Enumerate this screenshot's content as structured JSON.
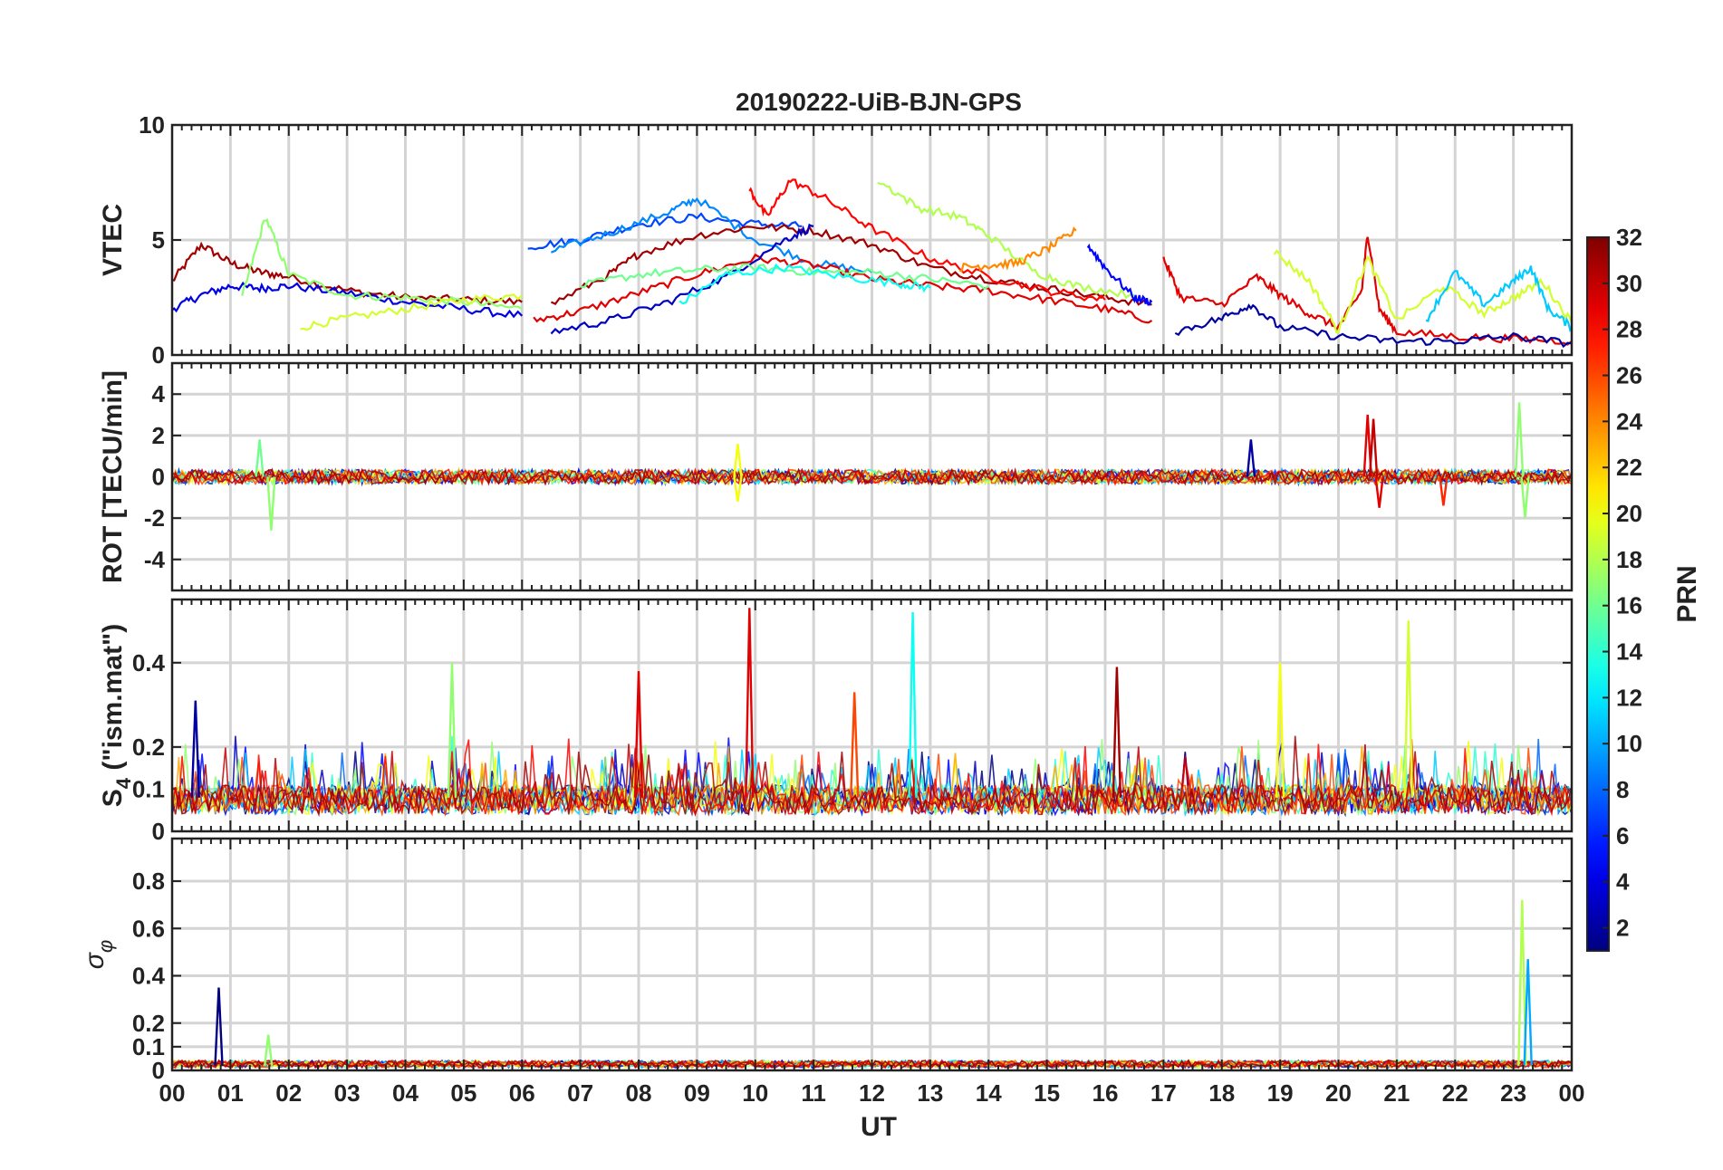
{
  "chart_data": {
    "type": "line",
    "title": "20190222-UiB-BJN-GPS",
    "xlabel": "UT",
    "x_tick_labels": [
      "00",
      "01",
      "02",
      "03",
      "04",
      "05",
      "06",
      "07",
      "08",
      "09",
      "10",
      "11",
      "12",
      "13",
      "14",
      "15",
      "16",
      "17",
      "18",
      "19",
      "20",
      "21",
      "22",
      "23",
      "00"
    ],
    "xlim": [
      0,
      24
    ],
    "grid": true,
    "colorbar": {
      "label": "PRN",
      "colormap": "jet",
      "range": [
        1,
        32
      ],
      "tick_labels": [
        "2",
        "4",
        "6",
        "8",
        "10",
        "12",
        "14",
        "16",
        "18",
        "20",
        "22",
        "24",
        "26",
        "28",
        "30",
        "32"
      ]
    },
    "panels": [
      {
        "id": "vtec",
        "ylabel": "VTEC",
        "ylim": [
          0,
          10
        ],
        "y_ticks": [
          0,
          5,
          10
        ],
        "y_tick_labels": [
          "0",
          "5",
          "10"
        ],
        "series": [
          {
            "prn": 31,
            "x": [
              0,
              0.5,
              1.0,
              1.5,
              2.0,
              3.0,
              4.0,
              5.0,
              6.0
            ],
            "y": [
              3.2,
              4.8,
              4.0,
              3.6,
              3.4,
              2.8,
              2.5,
              2.4,
              2.3
            ]
          },
          {
            "prn": 4,
            "x": [
              0,
              0.5,
              1.0,
              1.5,
              2.0,
              3.0,
              4.0,
              5.0,
              6.0
            ],
            "y": [
              2.0,
              2.6,
              3.0,
              2.9,
              3.0,
              2.7,
              2.3,
              2.0,
              1.7
            ]
          },
          {
            "prn": 17,
            "x": [
              1.2,
              1.6,
              2.0,
              3.0,
              4.0,
              5.0,
              6.0
            ],
            "y": [
              2.5,
              6.0,
              3.5,
              2.6,
              2.5,
              2.3,
              2.0
            ]
          },
          {
            "prn": 19,
            "x": [
              2.2,
              3.0,
              4.0,
              5.0,
              6.0
            ],
            "y": [
              1.2,
              1.6,
              2.0,
              2.4,
              2.6
            ]
          },
          {
            "prn": 7,
            "x": [
              6.1,
              7.0,
              8.0,
              9.0,
              10.0,
              10.8
            ],
            "y": [
              4.7,
              5.0,
              5.7,
              6.0,
              5.7,
              5.6
            ]
          },
          {
            "prn": 9,
            "x": [
              6.5,
              7.5,
              8.5,
              9.0,
              10.0,
              11.0,
              12.0
            ],
            "y": [
              4.5,
              5.3,
              6.2,
              6.8,
              5.0,
              4.0,
              3.6
            ]
          },
          {
            "prn": 29,
            "x": [
              6.2,
              7.0,
              8.0,
              9.0,
              10.0,
              11.0,
              12.0,
              13.0,
              14.0,
              15.0,
              16.0,
              16.8
            ],
            "y": [
              1.5,
              1.9,
              2.7,
              3.5,
              4.2,
              3.9,
              3.3,
              3.0,
              2.8,
              2.4,
              2.0,
              1.5
            ]
          },
          {
            "prn": 31,
            "x": [
              6.5,
              7.5,
              8.0,
              9.0,
              10.0,
              11.0,
              12.0,
              13.0,
              14.0,
              15.0,
              16.0,
              16.8
            ],
            "y": [
              2.2,
              3.5,
              4.4,
              5.2,
              5.6,
              5.4,
              4.8,
              3.8,
              3.3,
              2.9,
              2.5,
              2.2
            ]
          },
          {
            "prn": 3,
            "x": [
              6.5,
              7.5,
              8.5,
              9.5,
              10.5,
              11.0
            ],
            "y": [
              1.0,
              1.5,
              2.3,
              3.4,
              5.0,
              5.6
            ]
          },
          {
            "prn": 16,
            "x": [
              7.0,
              8.0,
              9.0,
              10.0,
              11.0,
              12.0,
              13.0,
              14.0
            ],
            "y": [
              3.0,
              3.5,
              3.7,
              3.8,
              3.6,
              3.6,
              3.3,
              3.0
            ]
          },
          {
            "prn": 13,
            "x": [
              8.7,
              9.5,
              10.5,
              11.5,
              12.5,
              13.0
            ],
            "y": [
              2.2,
              3.5,
              3.8,
              3.4,
              3.1,
              2.9
            ]
          },
          {
            "prn": 28,
            "x": [
              9.9,
              10.2,
              10.6,
              11.2,
              12.0,
              13.0,
              14.0,
              15.0,
              16.0
            ],
            "y": [
              7.2,
              6.0,
              7.6,
              6.8,
              5.5,
              4.2,
              3.4,
              2.8,
              2.4
            ]
          },
          {
            "prn": 18,
            "x": [
              12.1,
              12.8,
              13.5,
              14.0,
              14.8,
              15.5,
              16.5
            ],
            "y": [
              7.6,
              6.4,
              6.0,
              5.2,
              3.6,
              3.0,
              2.6
            ]
          },
          {
            "prn": 24,
            "x": [
              13.5,
              14.0,
              14.5,
              15.0,
              15.5
            ],
            "y": [
              3.8,
              3.9,
              4.0,
              4.6,
              5.4
            ]
          },
          {
            "prn": 5,
            "x": [
              15.7,
              16.0,
              16.5,
              16.8
            ],
            "y": [
              4.8,
              3.8,
              2.5,
              2.3
            ]
          },
          {
            "prn": 29,
            "x": [
              17.0,
              17.3,
              18.0,
              18.6,
              19.0,
              19.5,
              20.0,
              20.4,
              20.5,
              20.7,
              21.0,
              22.0,
              23.0,
              24.0
            ],
            "y": [
              4.2,
              2.5,
              2.2,
              3.4,
              2.6,
              1.8,
              1.2,
              2.8,
              5.3,
              2.0,
              1.0,
              0.8,
              0.7,
              0.6
            ]
          },
          {
            "prn": 19,
            "x": [
              18.9,
              19.5,
              20.0,
              20.5,
              21.0,
              21.8,
              22.5,
              23.0,
              23.5,
              24.0
            ],
            "y": [
              4.5,
              3.2,
              1.0,
              4.2,
              1.5,
              3.0,
              1.8,
              2.5,
              3.2,
              1.4
            ]
          },
          {
            "prn": 11,
            "x": [
              21.5,
              22.0,
              22.5,
              23.0,
              23.3,
              23.6,
              24.0
            ],
            "y": [
              1.5,
              3.6,
              2.2,
              3.2,
              3.8,
              2.0,
              1.2
            ]
          },
          {
            "prn": 2,
            "x": [
              17.2,
              18.0,
              18.5,
              19.0,
              20.0,
              21.0,
              22.0,
              23.0,
              24.0
            ],
            "y": [
              1.0,
              1.6,
              2.2,
              1.2,
              0.8,
              0.6,
              0.6,
              0.8,
              0.5
            ]
          }
        ]
      },
      {
        "id": "rot",
        "ylabel": "ROT [TECU/min]",
        "ylim": [
          -5.5,
          5.5
        ],
        "y_ticks": [
          -4,
          -2,
          0,
          2,
          4
        ],
        "y_tick_labels": [
          "-4",
          "-2",
          "0",
          "2",
          "4"
        ],
        "spikes": [
          {
            "prn": 17,
            "x": 1.7,
            "y": -2.6
          },
          {
            "prn": 16,
            "x": 1.5,
            "y": 1.8
          },
          {
            "prn": 20,
            "x": 9.7,
            "y": 1.6
          },
          {
            "prn": 20,
            "x": 9.7,
            "y": -1.2
          },
          {
            "prn": 2,
            "x": 18.5,
            "y": 1.8
          },
          {
            "prn": 29,
            "x": 20.5,
            "y": 3.0
          },
          {
            "prn": 30,
            "x": 20.6,
            "y": 2.8
          },
          {
            "prn": 29,
            "x": 20.7,
            "y": -1.5
          },
          {
            "prn": 17,
            "x": 23.1,
            "y": 3.6
          },
          {
            "prn": 17,
            "x": 23.2,
            "y": -2.0
          },
          {
            "prn": 27,
            "x": 21.8,
            "y": -1.4
          }
        ]
      },
      {
        "id": "s4",
        "ylabel": "S4 (\"ism.mat\")",
        "ylabel_main": "S",
        "ylabel_sub": "4",
        "ylabel_rest": " (\"ism.mat\")",
        "ylim": [
          0,
          0.55
        ],
        "y_ticks": [
          0,
          0.1,
          0.2,
          0.4
        ],
        "y_tick_labels": [
          "0",
          "0.1",
          "0.2",
          "0.4"
        ],
        "peaks": [
          {
            "prn": 2,
            "x": 0.4,
            "y": 0.31
          },
          {
            "prn": 17,
            "x": 4.8,
            "y": 0.4
          },
          {
            "prn": 29,
            "x": 9.9,
            "y": 0.53
          },
          {
            "prn": 13,
            "x": 12.7,
            "y": 0.52
          },
          {
            "prn": 31,
            "x": 16.2,
            "y": 0.39
          },
          {
            "prn": 19,
            "x": 21.2,
            "y": 0.5
          },
          {
            "prn": 29,
            "x": 8.0,
            "y": 0.38
          },
          {
            "prn": 20,
            "x": 19.0,
            "y": 0.4
          },
          {
            "prn": 26,
            "x": 11.7,
            "y": 0.33
          }
        ]
      },
      {
        "id": "sigphi",
        "ylabel": "σ φ",
        "ylabel_main": "σ",
        "ylabel_sub": "φ",
        "ylim": [
          0,
          0.98
        ],
        "y_ticks": [
          0,
          0.1,
          0.2,
          0.4,
          0.6,
          0.8
        ],
        "y_tick_labels": [
          "0",
          "0.1",
          "0.2",
          "0.4",
          "0.6",
          "0.8"
        ],
        "spikes": [
          {
            "prn": 1,
            "x": 0.8,
            "y": 0.35
          },
          {
            "prn": 17,
            "x": 1.65,
            "y": 0.15
          },
          {
            "prn": 18,
            "x": 23.15,
            "y": 0.72
          },
          {
            "prn": 10,
            "x": 23.25,
            "y": 0.47
          }
        ]
      }
    ]
  }
}
